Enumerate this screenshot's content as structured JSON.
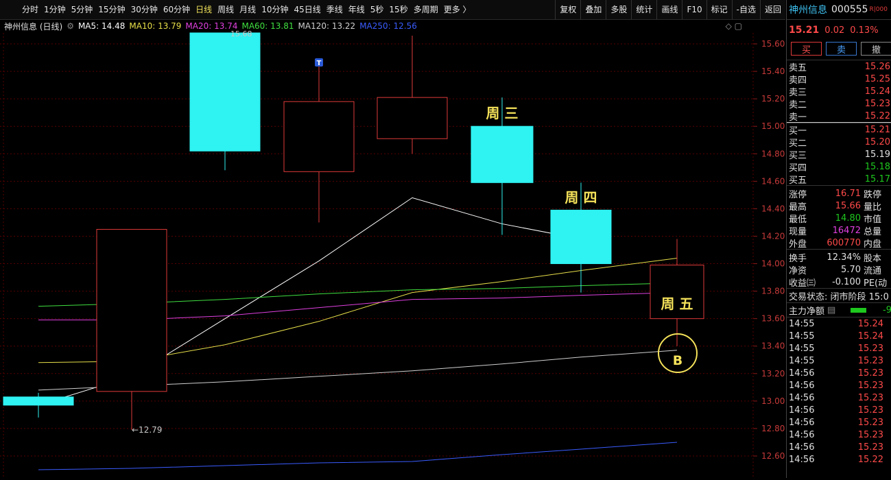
{
  "toolbar": {
    "periods": [
      "分时",
      "1分钟",
      "5分钟",
      "15分钟",
      "30分钟",
      "60分钟",
      "日线",
      "周线",
      "月线",
      "10分钟",
      "45日线",
      "季线",
      "年线",
      "5秒",
      "15秒",
      "多周期",
      "更多 〉"
    ],
    "active_period": "日线",
    "right": [
      "复权",
      "叠加",
      "多股",
      "统计",
      "画线",
      "F10",
      "标记",
      "-自选",
      "返回"
    ]
  },
  "indicator_bar": {
    "title": "神州信息 (日线)",
    "ma": [
      {
        "label": "MA5: 14.48",
        "color": "#ffffff"
      },
      {
        "label": "MA10: 13.79",
        "color": "#e8e04a"
      },
      {
        "label": "MA20: 13.74",
        "color": "#e040e0"
      },
      {
        "label": "MA60: 13.81",
        "color": "#40e040"
      },
      {
        "label": "MA120: 13.22",
        "color": "#d0d0d0"
      },
      {
        "label": "MA250: 12.56",
        "color": "#3a5cff"
      }
    ]
  },
  "chart": {
    "y_ticks": [
      "15.60",
      "15.40",
      "15.20",
      "15.00",
      "14.80",
      "14.60",
      "14.40",
      "14.20",
      "14.00",
      "13.80",
      "13.60",
      "13.40",
      "13.20",
      "13.00",
      "12.80",
      "12.60"
    ],
    "annotations": {
      "high_label": "15.68",
      "low_label": "←12.79",
      "day_labels": [
        "周 三",
        "周 四",
        "周 五"
      ],
      "buy_marker": "B",
      "t_marker": "T"
    }
  },
  "chart_data": {
    "type": "candlestick",
    "candles": [
      {
        "open": 12.97,
        "close": 13.03,
        "high": 13.06,
        "low": 12.88,
        "up": false
      },
      {
        "open": 13.07,
        "close": 14.25,
        "high": 14.25,
        "low": 12.79,
        "up": true
      },
      {
        "open": 14.82,
        "close": 15.68,
        "high": 15.68,
        "low": 14.68,
        "up": false
      },
      {
        "open": 14.67,
        "close": 15.18,
        "high": 15.47,
        "low": 14.3,
        "up": true
      },
      {
        "open": 14.91,
        "close": 15.21,
        "high": 15.66,
        "low": 14.8,
        "up": true
      },
      {
        "open": 15.0,
        "close": 14.59,
        "high": 15.21,
        "low": 14.21,
        "up": false
      },
      {
        "open": 14.39,
        "close": 14.0,
        "high": 14.59,
        "low": 13.79,
        "up": false
      },
      {
        "open": 13.6,
        "close": 13.99,
        "high": 14.18,
        "low": 13.4,
        "up": true
      }
    ],
    "ma_lines": [
      {
        "name": "MA5",
        "values": [
          12.97,
          13.18,
          13.6,
          14.02,
          14.48,
          14.29,
          14.18
        ]
      },
      {
        "name": "MA10",
        "values": [
          13.28,
          13.29,
          13.41,
          13.58,
          13.79,
          13.87,
          13.95,
          14.04
        ]
      },
      {
        "name": "MA20",
        "values": [
          13.59,
          13.59,
          13.62,
          13.68,
          13.74,
          13.75,
          13.77,
          13.79
        ]
      },
      {
        "name": "MA60",
        "values": [
          13.69,
          13.71,
          13.74,
          13.78,
          13.81,
          13.82,
          13.84,
          13.86
        ]
      },
      {
        "name": "MA120",
        "values": [
          13.08,
          13.11,
          13.14,
          13.18,
          13.22,
          13.27,
          13.32,
          13.37
        ]
      },
      {
        "name": "MA250",
        "values": [
          12.5,
          12.51,
          12.53,
          12.55,
          12.56,
          12.61,
          12.65,
          12.7
        ]
      }
    ],
    "ylim": [
      12.55,
      15.72
    ]
  },
  "quote": {
    "name": "神州信息",
    "code": "000555",
    "badge": "R|000",
    "price": "15.21",
    "change": "0.02",
    "pct": "0.13%",
    "buy_btn": "买",
    "sell_btn": "卖",
    "cancel_btn": "撤"
  },
  "order_book": {
    "sells": [
      {
        "label": "卖五",
        "price": "15.26",
        "color": "#ff4a4a"
      },
      {
        "label": "卖四",
        "price": "15.25",
        "color": "#ff4a4a"
      },
      {
        "label": "卖三",
        "price": "15.24",
        "color": "#ff4a4a"
      },
      {
        "label": "卖二",
        "price": "15.23",
        "color": "#ff4a4a"
      },
      {
        "label": "卖一",
        "price": "15.22",
        "color": "#ff4a4a"
      }
    ],
    "buys": [
      {
        "label": "买一",
        "price": "15.21",
        "color": "#ff4a4a"
      },
      {
        "label": "买二",
        "price": "15.20",
        "color": "#ff4a4a"
      },
      {
        "label": "买三",
        "price": "15.19",
        "color": "#e0e0e0"
      },
      {
        "label": "买四",
        "price": "15.18",
        "color": "#1ec81e"
      },
      {
        "label": "买五",
        "price": "15.17",
        "color": "#1ec81e"
      }
    ]
  },
  "stats": [
    {
      "l1": "涨停",
      "v": "16.71",
      "c": "#ff4a4a",
      "l2": "跌停"
    },
    {
      "l1": "最高",
      "v": "15.66",
      "c": "#ff4a4a",
      "l2": "量比"
    },
    {
      "l1": "最低",
      "v": "14.80",
      "c": "#1ec81e",
      "l2": "市值"
    },
    {
      "l1": "现量",
      "v": "16472",
      "c": "#e040e0",
      "l2": "总量"
    },
    {
      "l1": "外盘",
      "v": "600770",
      "c": "#ff4a4a",
      "l2": "内盘"
    }
  ],
  "stats2": [
    {
      "l1": "换手",
      "v": "12.34%",
      "c": "#e0e0e0",
      "l2": "股本"
    },
    {
      "l1": "净资",
      "v": "5.70",
      "c": "#e0e0e0",
      "l2": "流通"
    },
    {
      "l1": "收益㈢",
      "v": "-0.100",
      "c": "#e0e0e0",
      "l2": "PE(动"
    }
  ],
  "status": "交易状态: 闭市阶段 15:0",
  "flow": {
    "label": "主力净额",
    "num": "-9"
  },
  "ticks": [
    {
      "t": "14:55",
      "p": "15.24"
    },
    {
      "t": "14:55",
      "p": "15.24"
    },
    {
      "t": "14:55",
      "p": "15.23"
    },
    {
      "t": "14:55",
      "p": "15.23"
    },
    {
      "t": "14:56",
      "p": "15.23"
    },
    {
      "t": "14:56",
      "p": "15.23"
    },
    {
      "t": "14:56",
      "p": "15.23"
    },
    {
      "t": "14:56",
      "p": "15.23"
    },
    {
      "t": "14:56",
      "p": "15.23"
    },
    {
      "t": "14:56",
      "p": "15.23"
    },
    {
      "t": "14:56",
      "p": "15.23"
    },
    {
      "t": "14:56",
      "p": "15.22"
    }
  ]
}
